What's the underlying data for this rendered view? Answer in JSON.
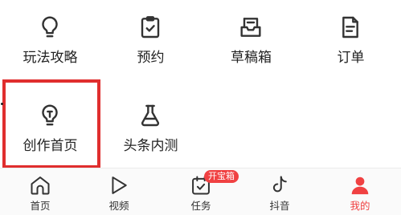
{
  "grid": {
    "items": [
      {
        "label": "玩法攻略",
        "icon": "lightbulb-icon"
      },
      {
        "label": "预约",
        "icon": "clipboard-check-icon"
      },
      {
        "label": "草稿箱",
        "icon": "draft-box-icon"
      },
      {
        "label": "订单",
        "icon": "order-document-icon"
      },
      {
        "label": "创作首页",
        "icon": "lightbulb-t-icon",
        "highlighted": true
      },
      {
        "label": "头条内测",
        "icon": "flask-icon"
      }
    ]
  },
  "highlight_color": "#e02e2e",
  "bottom_nav": {
    "items": [
      {
        "label": "首页",
        "icon": "home-icon",
        "active": false
      },
      {
        "label": "视频",
        "icon": "play-icon",
        "active": false
      },
      {
        "label": "任务",
        "icon": "task-calendar-icon",
        "active": false,
        "badge": "开宝箱"
      },
      {
        "label": "抖音",
        "icon": "douyin-icon",
        "active": false
      },
      {
        "label": "我的",
        "icon": "profile-icon",
        "active": true
      }
    ],
    "active_color": "#f04142"
  },
  "colors": {
    "text": "#222222",
    "icon": "#333333",
    "badge": "#f04142"
  }
}
